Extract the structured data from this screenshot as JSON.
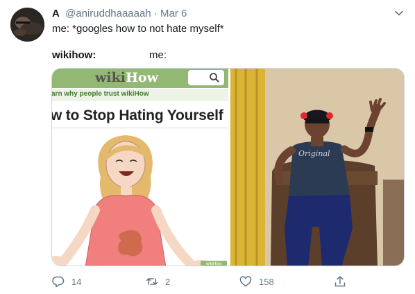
{
  "tweet": {
    "display_name": "A",
    "handle": "@aniruddhaaaaah",
    "separator": "·",
    "date": "Mar 6",
    "text": "me: *googles how to not hate myself*",
    "caption_left": "wikihow:",
    "caption_right": "me:"
  },
  "meme_left": {
    "logo_wiki": "wiki",
    "logo_how": "How",
    "tagline": "arn why people trust wikiHow",
    "title": "w to Stop Hating Yourself",
    "badge": "wikiHow"
  },
  "meme_right": {
    "shirt_text": "Original"
  },
  "actions": {
    "reply_count": "14",
    "retweet_count": "2",
    "like_count": "158",
    "share_label": ""
  },
  "icons": {
    "reply": "reply-icon",
    "retweet": "retweet-icon",
    "like": "heart-icon",
    "share": "share-icon",
    "menu": "chevron-down-icon",
    "search": "search-icon"
  },
  "colors": {
    "wikihow_green": "#93b874",
    "text_secondary": "#657786",
    "text_primary": "#14171a"
  }
}
